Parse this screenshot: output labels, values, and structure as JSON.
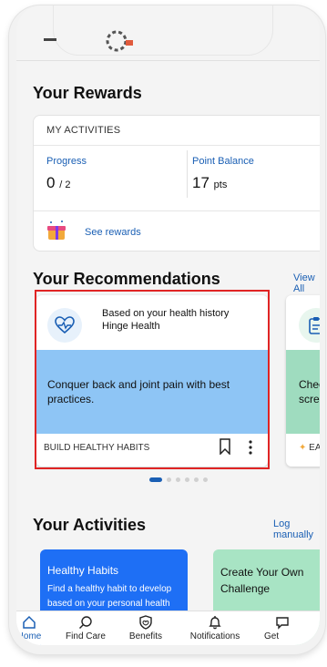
{
  "sections": {
    "rewards_title": "Your Rewards",
    "recommendations_title": "Your Recommendations",
    "activities_title": "Your Activities"
  },
  "rewards": {
    "header": "MY ACTIVITIES",
    "progress_label": "Progress",
    "progress_value": "0",
    "progress_total": "/ 2",
    "points_label": "Point Balance",
    "points_value": "17",
    "points_unit": "pts",
    "see_rewards": "See rewards"
  },
  "recommendations": {
    "view_all": "View All",
    "cards": [
      {
        "title": "Based on your health history",
        "subtitle": "Hinge Health",
        "body": "Conquer back and joint pain with best practices.",
        "footer": "BUILD HEALTHY HABITS",
        "band_color": "#8ec5f5"
      },
      {
        "body_line1": "Check",
        "body_line2": "screen",
        "footer": "EARN",
        "band_color": "#9fdcbf"
      }
    ],
    "carousel": {
      "count": 6,
      "active_index": 0
    }
  },
  "activities": {
    "log_manually": "Log manually",
    "cards": [
      {
        "title": "Healthy Habits",
        "description": "Find a healthy habit to develop based on your personal health goals",
        "color": "#1e6ff5"
      },
      {
        "title": "Create Your Own Challenge",
        "color": "#a8e4c4"
      }
    ]
  },
  "tabbar": [
    {
      "label": "Home",
      "icon": "home-icon"
    },
    {
      "label": "Find Care",
      "icon": "search-icon"
    },
    {
      "label": "Benefits",
      "icon": "shield-icon"
    },
    {
      "label": "Notifications",
      "icon": "bell-icon"
    },
    {
      "label": "Get",
      "icon": "chat-icon"
    }
  ],
  "colors": {
    "accent": "#1a5fb4",
    "highlight": "#e02424"
  }
}
